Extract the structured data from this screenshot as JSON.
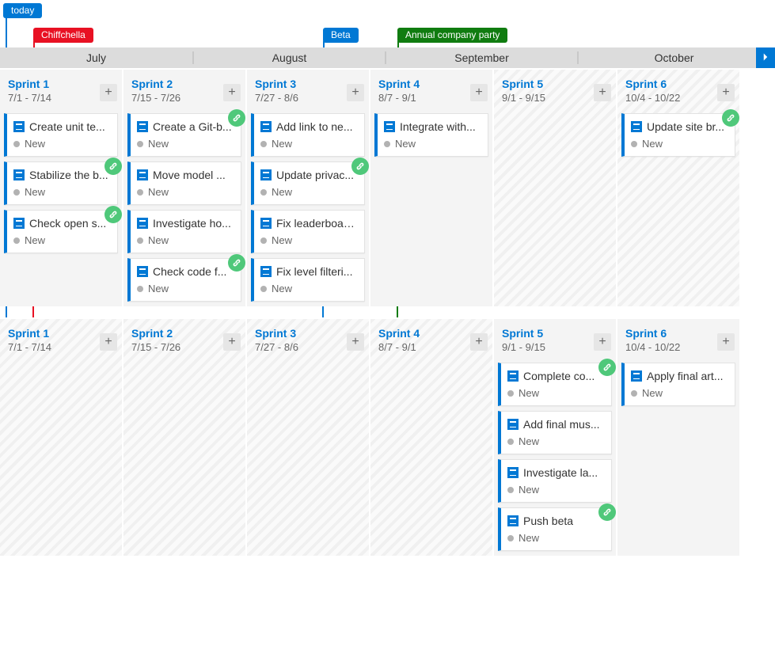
{
  "colors": {
    "blue": "#0078d4",
    "red": "#e81123",
    "green_event": "#107c10",
    "green_link": "#4fc87a"
  },
  "badges": {
    "today": "today",
    "chiff": "Chiffchella",
    "beta": "Beta",
    "party": "Annual company party"
  },
  "months": [
    "July",
    "August",
    "September",
    "October"
  ],
  "state_label": "New",
  "lanes": [
    {
      "name": "lane1",
      "sprints": [
        {
          "title": "Sprint 1",
          "dates": "7/1 - 7/14",
          "stripe": false,
          "cards": [
            {
              "title": "Create unit te...",
              "link": false
            },
            {
              "title": "Stabilize the b...",
              "link": true
            },
            {
              "title": "Check open s...",
              "link": true
            }
          ]
        },
        {
          "title": "Sprint 2",
          "dates": "7/15 - 7/26",
          "stripe": false,
          "cards": [
            {
              "title": "Create a Git-b...",
              "link": true
            },
            {
              "title": "Move model ...",
              "link": false
            },
            {
              "title": "Investigate ho...",
              "link": false
            },
            {
              "title": "Check code f...",
              "link": true
            }
          ]
        },
        {
          "title": "Sprint 3",
          "dates": "7/27 - 8/6",
          "stripe": false,
          "cards": [
            {
              "title": "Add link to ne...",
              "link": false
            },
            {
              "title": "Update privac...",
              "link": true
            },
            {
              "title": "Fix leaderboar...",
              "link": false
            },
            {
              "title": "Fix level filteri...",
              "link": false
            }
          ]
        },
        {
          "title": "Sprint 4",
          "dates": "8/7 - 9/1",
          "stripe": false,
          "cards": [
            {
              "title": "Integrate with...",
              "link": false
            }
          ]
        },
        {
          "title": "Sprint 5",
          "dates": "9/1 - 9/15",
          "stripe": true,
          "cards": []
        },
        {
          "title": "Sprint 6",
          "dates": "10/4 - 10/22",
          "stripe": true,
          "cards": [
            {
              "title": "Update site br...",
              "link": true
            }
          ]
        }
      ]
    },
    {
      "name": "lane2",
      "sprints": [
        {
          "title": "Sprint 1",
          "dates": "7/1 - 7/14",
          "stripe": true,
          "cards": []
        },
        {
          "title": "Sprint 2",
          "dates": "7/15 - 7/26",
          "stripe": true,
          "cards": []
        },
        {
          "title": "Sprint 3",
          "dates": "7/27 - 8/6",
          "stripe": true,
          "cards": []
        },
        {
          "title": "Sprint 4",
          "dates": "8/7 - 9/1",
          "stripe": true,
          "cards": []
        },
        {
          "title": "Sprint 5",
          "dates": "9/1 - 9/15",
          "stripe": false,
          "cards": [
            {
              "title": "Complete co...",
              "link": true
            },
            {
              "title": "Add final mus...",
              "link": false
            },
            {
              "title": "Investigate la...",
              "link": false
            },
            {
              "title": "Push beta",
              "link": true
            }
          ]
        },
        {
          "title": "Sprint 6",
          "dates": "10/4 - 10/22",
          "stripe": false,
          "cards": [
            {
              "title": "Apply final art...",
              "link": false
            }
          ]
        }
      ]
    }
  ]
}
